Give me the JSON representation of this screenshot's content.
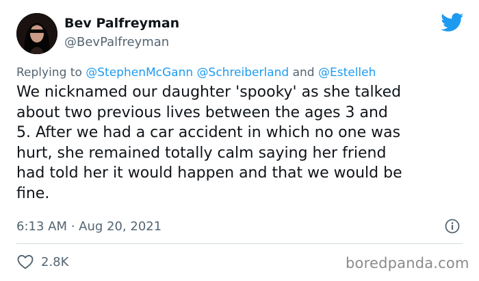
{
  "author": {
    "display_name": "Bev Palfreyman",
    "handle": "@BevPalfreyman",
    "avatar_icon": "avatar-photo"
  },
  "platform_icon": "twitter-bird-icon",
  "reply": {
    "prefix": "Replying to",
    "mention_1": "@StephenMcGann",
    "mention_2": "@Schreiberland",
    "conjunction": "and",
    "mention_3": "@Estelleh"
  },
  "tweet": {
    "text": "We nicknamed our daughter 'spooky' as she talked\nabout two previous lives between the ages 3 and\n5. After we had a car accident in which no one was\nhurt, she remained totally calm saying her friend\nhad told her it would happen and that we would be\nfine.",
    "timestamp": "6:13 AM · Aug 20, 2021"
  },
  "engagement": {
    "like_count": "2.8K"
  },
  "watermark": "boredpanda.com",
  "colors": {
    "twitter_blue": "#1d9bf0",
    "secondary_text": "#536471",
    "primary_text": "#0f1419",
    "divider": "#cfd9de"
  }
}
